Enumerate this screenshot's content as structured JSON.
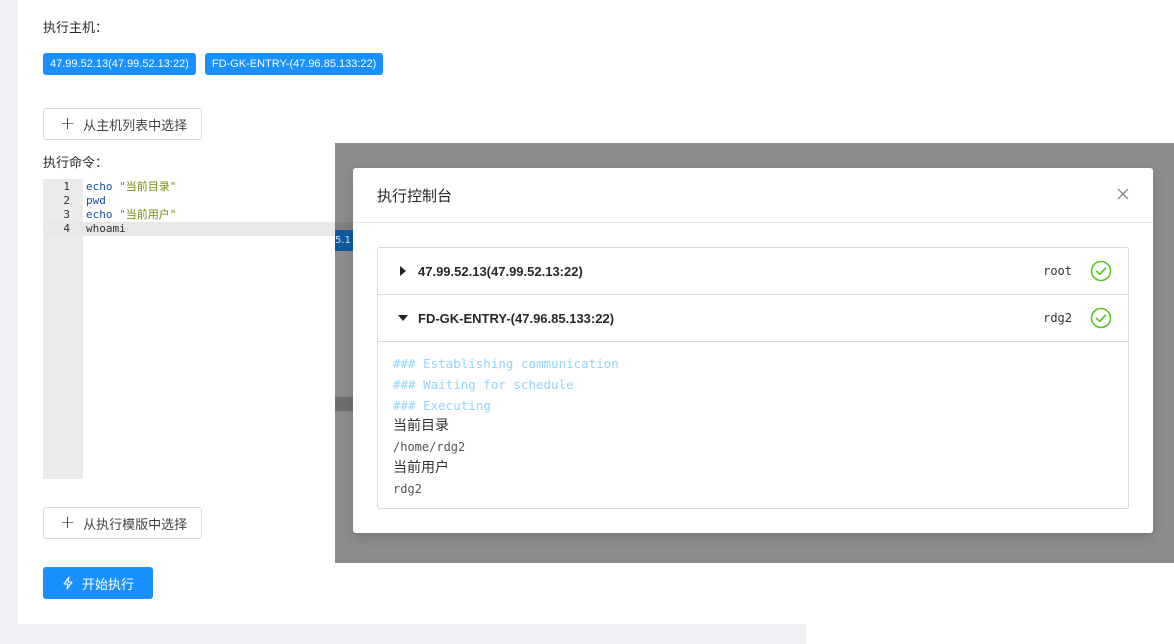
{
  "form": {
    "hosts_label": "执行主机：",
    "hosts": [
      "47.99.52.13(47.99.52.13:22)",
      "FD-GK-ENTRY-(47.96.85.133:22)"
    ],
    "select_host_button": "从主机列表中选择",
    "command_label": "执行命令：",
    "code_lines": [
      {
        "num": "1",
        "parts": [
          {
            "t": "echo ",
            "c": "kw"
          },
          {
            "t": "\"当前目录\"",
            "c": "str"
          }
        ]
      },
      {
        "num": "2",
        "parts": [
          {
            "t": "pwd",
            "c": "kw"
          }
        ]
      },
      {
        "num": "3",
        "parts": [
          {
            "t": "echo ",
            "c": "kw"
          },
          {
            "t": "\"当前用户\"",
            "c": "str"
          }
        ]
      },
      {
        "num": "4",
        "parts": [
          {
            "t": "whoami",
            "c": "plain"
          }
        ]
      }
    ],
    "select_template_button": "从执行模版中选择",
    "start_button": "开始执行"
  },
  "modal": {
    "title": "执行控制台",
    "ghost_tag_fragment": "5.1",
    "hosts": [
      {
        "title": "47.99.52.13(47.99.52.13:22)",
        "user": "root",
        "expanded": false,
        "status": "success"
      },
      {
        "title": "FD-GK-ENTRY-(47.96.85.133:22)",
        "user": "rdg2",
        "expanded": true,
        "status": "success"
      }
    ],
    "output": [
      {
        "text": "### Establishing communication",
        "kind": "sys"
      },
      {
        "text": "### Waiting for schedule",
        "kind": "sys"
      },
      {
        "text": "### Executing",
        "kind": "sys"
      },
      {
        "text": "当前目录",
        "kind": "cn"
      },
      {
        "text": "/home/rdg2",
        "kind": "mono"
      },
      {
        "text": "当前用户",
        "kind": "cn"
      },
      {
        "text": "rdg2",
        "kind": "mono"
      }
    ]
  },
  "colors": {
    "primary": "#1890ff",
    "success": "#52c41a",
    "overlay": "rgba(0,0,0,0.45)"
  }
}
